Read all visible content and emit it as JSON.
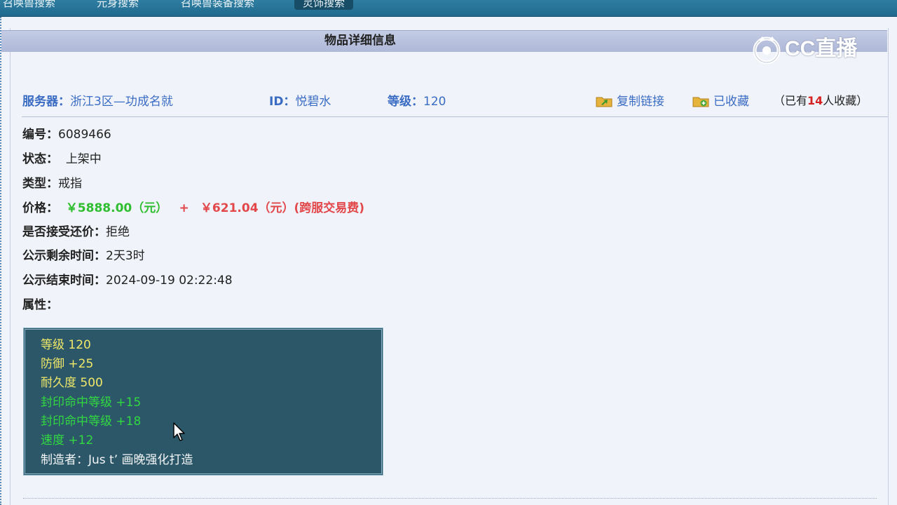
{
  "nav": {
    "tabs": [
      "召唤兽搜索",
      "元身搜索",
      "召唤兽装备搜索",
      "灵饰搜索"
    ],
    "active_tab": "灵饰搜索"
  },
  "page": {
    "title": "物品详细信息"
  },
  "watermark": {
    "text": "CC直播"
  },
  "info": {
    "server_label": "服务器：",
    "server_value": "浙江3区—功成名就",
    "id_label": "ID：",
    "id_value": "悦碧水",
    "level_label": "等级：",
    "level_value": "120",
    "copy_link": "复制链接",
    "favorited": "已收藏",
    "fav_prefix": "（已有",
    "fav_count": "14",
    "fav_suffix": "人收藏）"
  },
  "details": {
    "number_label": "编号：",
    "number_value": "6089466",
    "status_label": "状态：",
    "status_value": "上架中",
    "type_label": "类型：",
    "type_value": "戒指",
    "price_label": "价格：",
    "price_main": "￥5888.00（元）",
    "price_plus": "+",
    "price_fee": "￥621.04（元）(跨服交易费)",
    "bargain_label": "是否接受还价：",
    "bargain_value": "拒绝",
    "remaining_label": "公示剩余时间：",
    "remaining_value": "2天3时",
    "end_label": "公示结束时间：",
    "end_value": "2024-09-19 02:22:48",
    "attr_label": "属性："
  },
  "attributes": [
    {
      "text": "等级 120",
      "color": "yellow"
    },
    {
      "text": "防御 +25",
      "color": "yellow"
    },
    {
      "text": "耐久度 500",
      "color": "yellow"
    },
    {
      "text": "封印命中等级 +15",
      "color": "green"
    },
    {
      "text": "封印命中等级 +18",
      "color": "green"
    },
    {
      "text": "速度 +12",
      "color": "green"
    },
    {
      "text": "制造者：Jus t’ 画晚强化打造",
      "color": "white"
    }
  ],
  "colors": {
    "nav_bg": "#1f6a8e",
    "link": "#3a6cc4",
    "price_green": "#2fbe2f",
    "price_red": "#e2474a",
    "attr_bg": "#2c5768"
  }
}
